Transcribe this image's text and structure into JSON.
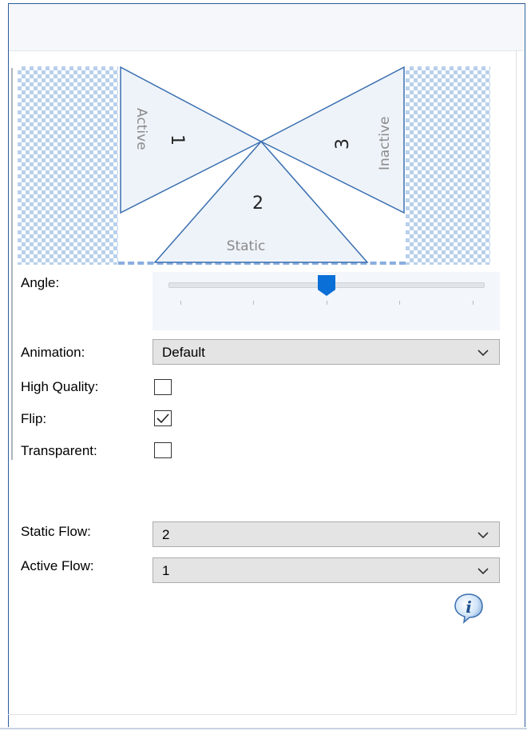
{
  "preview": {
    "region1": {
      "number": "1",
      "label": "Active"
    },
    "region2": {
      "number": "2",
      "label": "Static"
    },
    "region3": {
      "number": "3",
      "label": "Inactive"
    }
  },
  "angle": {
    "label": "Angle:",
    "value_fraction": 0.5,
    "tick_count": 5
  },
  "animation": {
    "label": "Animation:",
    "value": "Default"
  },
  "high_quality": {
    "label": "High Quality:",
    "checked": false
  },
  "flip": {
    "label": "Flip:",
    "checked": true
  },
  "transparent": {
    "label": "Transparent:",
    "checked": false
  },
  "static_flow": {
    "label": "Static Flow:",
    "value": "2"
  },
  "active_flow": {
    "label": "Active Flow:",
    "value": "1"
  },
  "info_icon": "info-icon",
  "colors": {
    "accent": "#0a6fd6",
    "checker": "#b8d0ea",
    "triangle_fill": "#eef3f9",
    "triangle_stroke": "#3a6fb0"
  }
}
